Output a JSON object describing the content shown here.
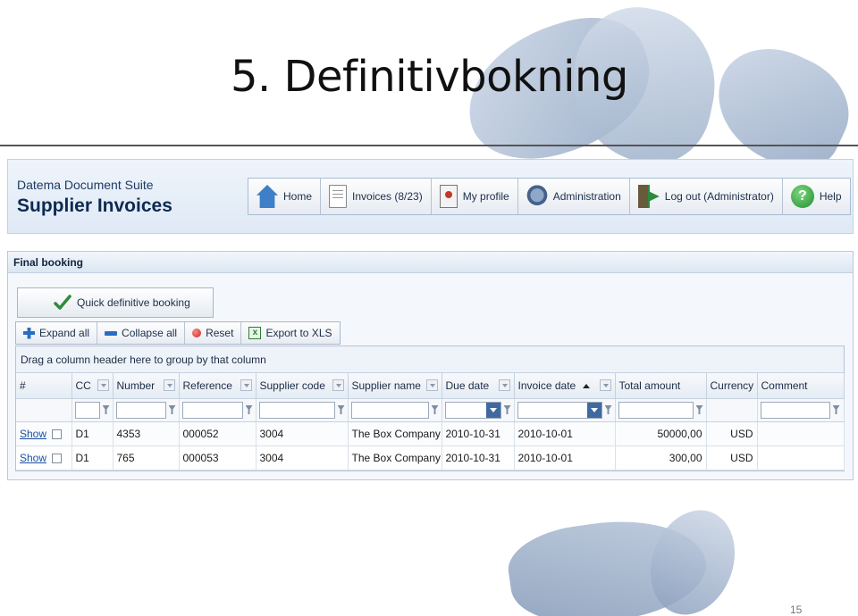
{
  "slide": {
    "title": "5. Definitivbokning",
    "page_number": "15"
  },
  "app": {
    "suite_name": "Datema Document Suite",
    "app_name": "Supplier Invoices",
    "nav": [
      {
        "label": "Home",
        "icon": "home-icon"
      },
      {
        "label": "Invoices (8/23)",
        "icon": "document-icon"
      },
      {
        "label": "My profile",
        "icon": "profile-icon"
      },
      {
        "label": "Administration",
        "icon": "admin-icon"
      },
      {
        "label": "Log out (Administrator)",
        "icon": "logout-icon"
      },
      {
        "label": "Help",
        "icon": "help-icon"
      }
    ]
  },
  "panel": {
    "title": "Final booking",
    "quick_booking_label": "Quick definitive booking",
    "toolbar": {
      "expand_all": "Expand all",
      "collapse_all": "Collapse all",
      "reset": "Reset",
      "export_xls": "Export to XLS"
    }
  },
  "grid": {
    "group_hint": "Drag a column header here to group by that column",
    "columns": [
      "#",
      "CC",
      "Number",
      "Reference",
      "Supplier code",
      "Supplier name",
      "Due date",
      "Invoice date",
      "Total amount",
      "Currency",
      "Comment"
    ],
    "sorted_column": "Invoice date",
    "sort_direction": "ascending",
    "rows": [
      {
        "action": "Show",
        "cc": "D1",
        "number": "4353",
        "reference": "000052",
        "supplier_code": "3004",
        "supplier_name": "The Box Company",
        "due_date": "2010-10-31",
        "invoice_date": "2010-10-01",
        "total_amount": "50000,00",
        "currency": "USD",
        "comment": ""
      },
      {
        "action": "Show",
        "cc": "D1",
        "number": "765",
        "reference": "000053",
        "supplier_code": "3004",
        "supplier_name": "The Box Company",
        "due_date": "2010-10-31",
        "invoice_date": "2010-10-01",
        "total_amount": "300,00",
        "currency": "USD",
        "comment": ""
      }
    ]
  },
  "colors": {
    "header_bg": "#dfe9f5",
    "app_title": "#0e2a52",
    "link": "#1a4fa0",
    "check_green": "#2e8b3a"
  }
}
